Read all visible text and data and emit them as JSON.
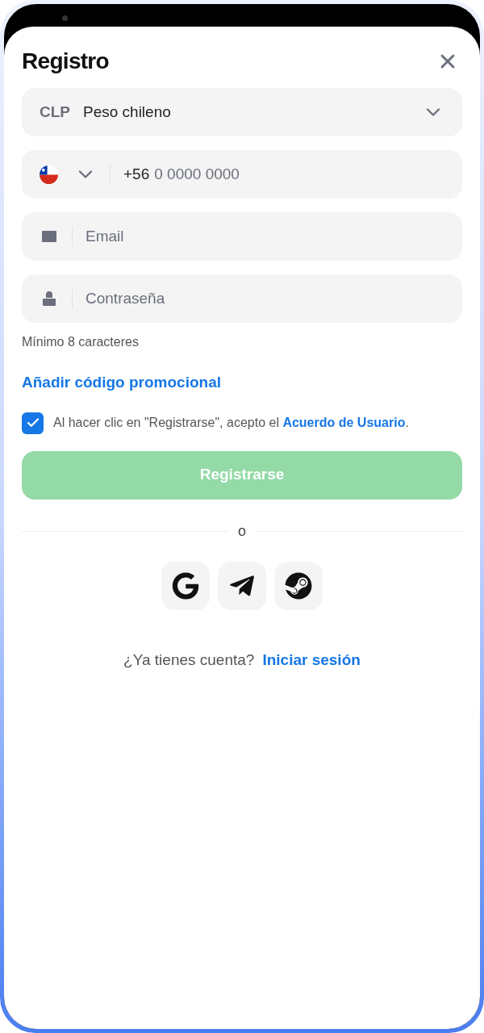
{
  "dialog": {
    "title": "Registro"
  },
  "currency": {
    "code": "CLP",
    "name": "Peso chileno"
  },
  "phone": {
    "prefix": "+56",
    "placeholder": "0 0000 0000"
  },
  "email": {
    "placeholder": "Email"
  },
  "password": {
    "placeholder": "Contraseña",
    "hint": "Mínimo 8 caracteres"
  },
  "promo_link": "Añadir código promocional",
  "agreement": {
    "checked": true,
    "text": "Al hacer clic en \"Registrarse\", acepto el",
    "link": "Acuerdo de Usuario",
    "suffix": "."
  },
  "submit": {
    "label": "Registrarse",
    "disabled": true
  },
  "separator": "o",
  "social": [
    {
      "kind": "google"
    },
    {
      "kind": "telegram"
    },
    {
      "kind": "steam"
    }
  ],
  "login": {
    "prompt": "¿Ya tienes cuenta?",
    "link": "Iniciar sesión"
  }
}
